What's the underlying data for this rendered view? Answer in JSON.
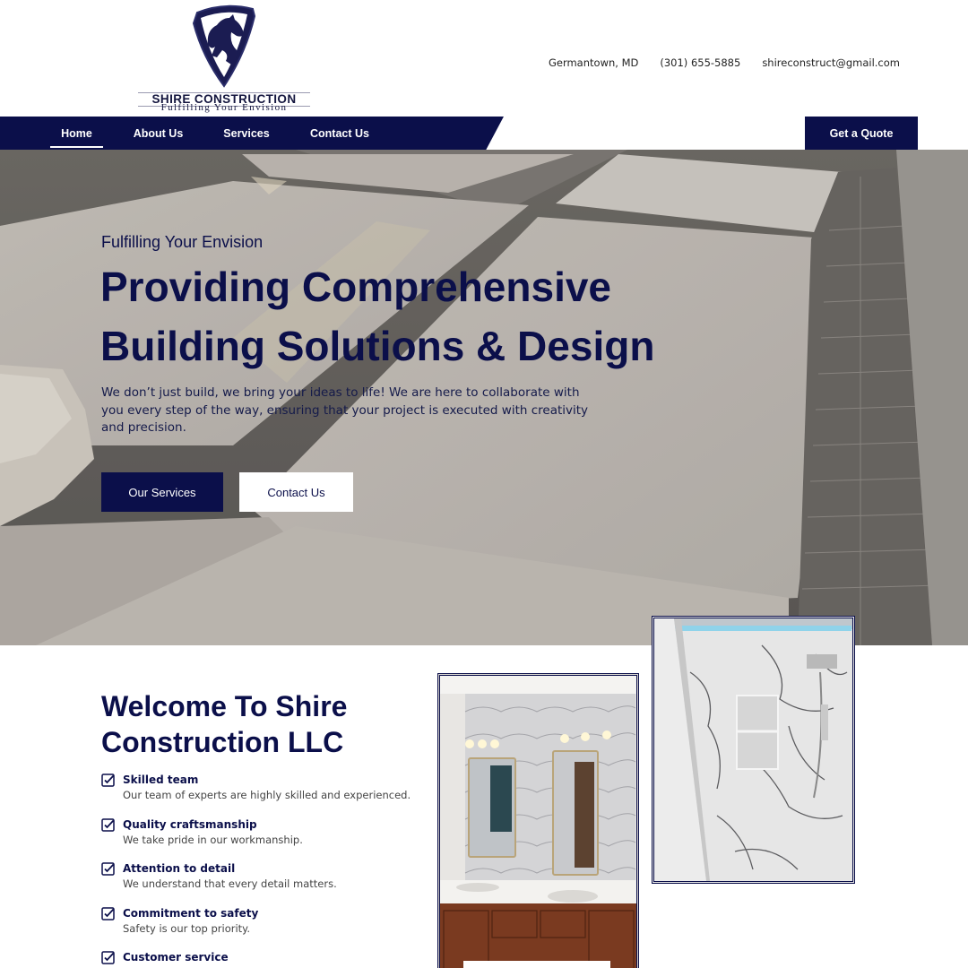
{
  "brand": {
    "name": "SHIRE CONSTRUCTION",
    "tagline": "Fulfilling Your Envision"
  },
  "contact": {
    "location": "Germantown, MD",
    "phone": "(301) 655-5885",
    "email": "shireconstruct@gmail.com"
  },
  "nav": {
    "items": [
      {
        "label": "Home",
        "active": true
      },
      {
        "label": "About Us"
      },
      {
        "label": "Services"
      },
      {
        "label": "Contact Us"
      }
    ],
    "cta": "Get a Quote"
  },
  "hero": {
    "kicker": "Fulfilling Your Envision",
    "title": "Providing Comprehensive Building Solutions & Design",
    "description": "We don’t just build, we bring your ideas to life! We are here to collaborate with you every step of the way, ensuring that your project is executed with creativity and precision.",
    "primary_button": "Our Services",
    "secondary_button": "Contact Us"
  },
  "welcome": {
    "title": "Welcome To Shire Construction LLC",
    "features": [
      {
        "title": "Skilled team",
        "description": "Our team of experts are highly skilled and experienced."
      },
      {
        "title": "Quality craftsmanship",
        "description": "We take pride in our workmanship."
      },
      {
        "title": "Attention to detail",
        "description": "We understand that every detail matters."
      },
      {
        "title": "Commitment to safety",
        "description": "Safety is our top priority."
      },
      {
        "title": "Customer service",
        "description": ""
      }
    ]
  },
  "colors": {
    "brand_navy": "#0b0f4a",
    "white": "#ffffff"
  },
  "icons": {
    "logo": "horse-shield-icon",
    "feature": "checkbox-check-icon"
  }
}
